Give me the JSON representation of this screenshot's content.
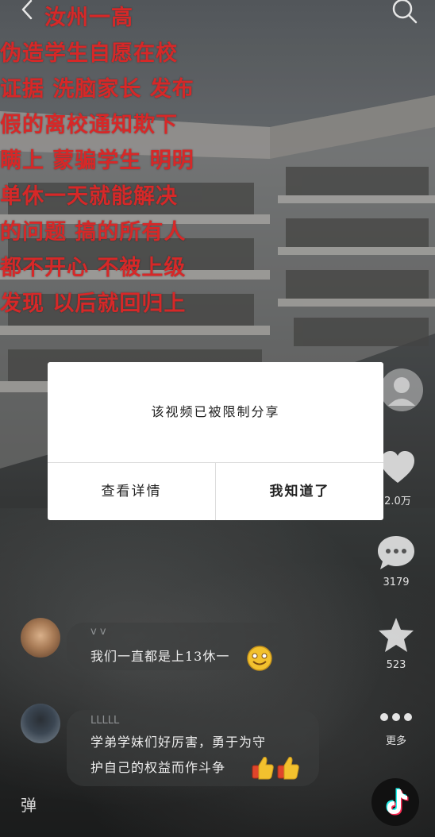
{
  "overlay": {
    "lines": [
      "汝州一高",
      "伪造学生自愿在校",
      "证据 洗脑家长 发布",
      "假的离校通知欺下",
      "瞒上 蒙骗学生 明明",
      "单休一天就能解决",
      "的问题 搞的所有人",
      "都不开心 不被上级",
      "发现 以后就回归上"
    ],
    "color": "#d62828"
  },
  "topbar": {
    "back_icon": "chevron-left-icon",
    "search_icon": "search-icon"
  },
  "dialog": {
    "message": "该视频已被限制分享",
    "details_label": "查看详情",
    "ok_label": "我知道了"
  },
  "rail": {
    "likes": "2.0万",
    "comments": "3179",
    "favorites": "523",
    "more": "更多"
  },
  "comments": [
    {
      "user": "v v",
      "text": "我们一直都是上13休一"
    },
    {
      "user": "LLLLL",
      "text_line1": "学弟学妹们好厉害，勇于为守",
      "text_line2": "护自己的权益而作斗争"
    }
  ],
  "danmu_label": "弹"
}
